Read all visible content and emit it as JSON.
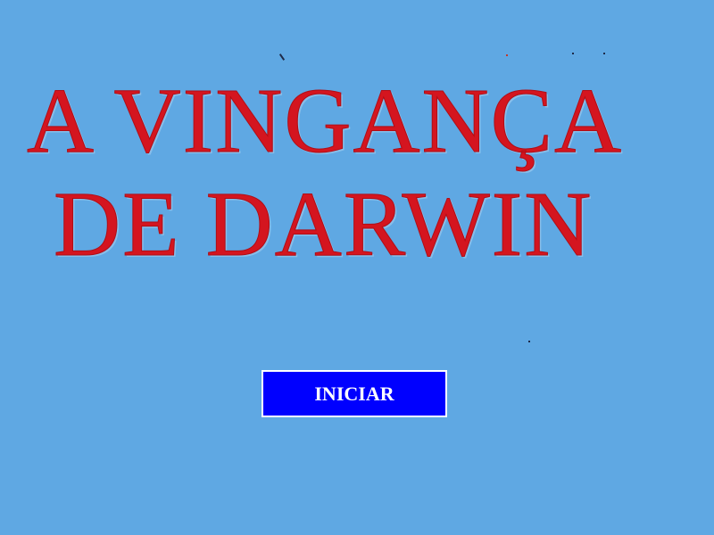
{
  "game": {
    "title_line_1": "A Vingança",
    "title_line_2": "de Darwin",
    "start_button_label": "INICIAR"
  },
  "colors": {
    "background": "#5fa8e3",
    "title": "#d4151f",
    "button_fill": "#0000ff",
    "button_border": "#ffffff",
    "button_text": "#ffffff"
  }
}
